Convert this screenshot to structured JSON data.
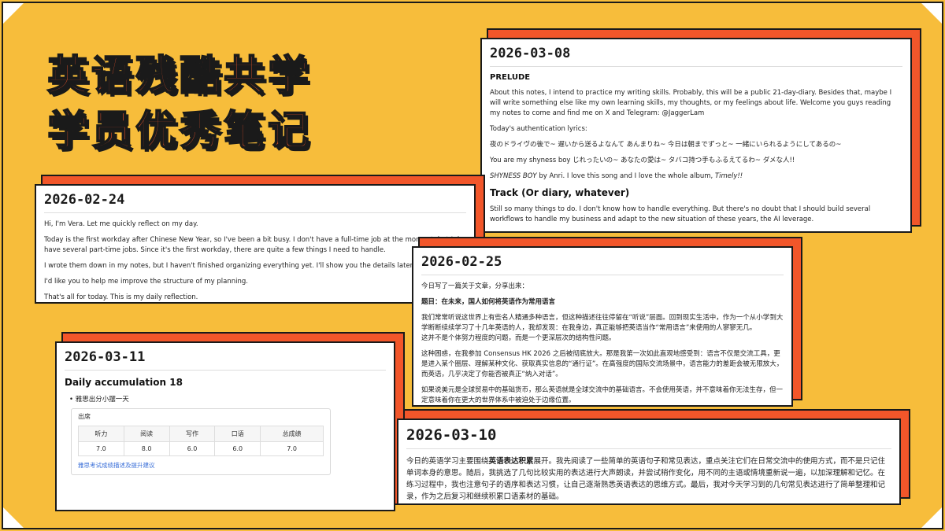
{
  "headline": {
    "line1": "英语残酷共学",
    "line2": "学员优秀笔记"
  },
  "cards": {
    "c0308": {
      "date": "2026-03-08",
      "h1": "PRELUDE",
      "p1": "About this notes, I intend to practice my writing skills. Probably, this will be a public 21-day-diary. Besides that, maybe I will write something else like my own learning skills, my thoughts, or my feelings about life. Welcome you guys reading my notes to come and find me on X and Telegram: @JaggerLam",
      "p2": "Today's authentication lyrics:",
      "p3": "夜のドライヴの後で~ 遅いから送るよなんて あんまりね~ 今日は朝までずっと~ 一緒にいられるようにしてあるの~",
      "p4": "You are my shyness boy じれったいの~ あなたの愛は~ タバコ持つ手もふるえてるわ~ ダメな人!!",
      "p5_song": "SHYNESS BOY",
      "p5_mid": " by Anri. I love this song and I love the whole album, ",
      "p5_album": "Timely!!",
      "h2": "Track (Or diary, whatever)",
      "p6": "Still so many things to do. I don't know how to handle everything. But there's no doubt that I should build several workflows to handle my business and adapt to the new situation of these years, the AI leverage."
    },
    "c0224": {
      "date": "2026-02-24",
      "p1": "Hi, I'm Vera. Let me quickly reflect on my day.",
      "p2": "Today is the first workday after Chinese New Year, so I've been a bit busy. I don't have a full-time job at the moment, but I do have several part-time jobs. Since it's the first workday, there are quite a few things I need to handle.",
      "p3": "I wrote them down in my notes, but I haven't finished organizing everything yet. I'll show you the details later.",
      "p4": "I'd like you to help me improve the structure of my planning.",
      "p5": "That's all for today. This is my daily reflection."
    },
    "c0225": {
      "date": "2026-02-25",
      "p1": "今日写了一篇关于文章，分享出来：",
      "p2": "题目：在未来，国人如何将英语作为常用语言",
      "p3": "我们常常听说这世界上有些名人精通多种语言，但这种描述往往停留在“听说”层面。回到现实生活中，作为一个从小学到大学断断续续学习了十几年英语的人，我却发现：在我身边，真正能够把英语当作“常用语言”来使用的人寥寥无几。",
      "p3b": "这并不是个体努力程度的问题，而是一个更深层次的结构性问题。",
      "p4": "这种困惑，在我参加 Consensus HK 2026 之后被彻底放大。那是我第一次如此直观地感受到：语言不仅是交流工具，更是进入某个圈层、理解某种文化、获取真实信息的“通行证”。在高强度的国际交流场景中，语言能力的差距会被无限放大，而英语，几乎决定了你能否被真正“纳入对话”。",
      "p5": "如果说美元是全球贸易中的基础货币，那么英语就是全球交流中的基础语言。不会使用英语，并不意味着你无法生存，但一定意味着你在更大的世界体系中被迫处于边缘位置。"
    },
    "c0311": {
      "date": "2026-03-11",
      "title": "Daily accumulation 18",
      "bullet": "雅思出分小摆一天",
      "sub_title": "出席",
      "headers": [
        "听力",
        "阅读",
        "写作",
        "口语",
        "总成绩"
      ],
      "scores": [
        "7.0",
        "8.0",
        "6.0",
        "6.0",
        "7.0"
      ],
      "link": "雅思考试成绩描述及提升建议"
    },
    "c0310": {
      "date": "2026-03-10",
      "p_a": "今日的英语学习主要围绕",
      "p_b": "英语表达积累",
      "p_c": "展开。我先阅读了一些简单的英语句子和常见表达，重点关注它们在日常交流中的使用方式，而不是只记住单词本身的意思。随后，我挑选了几句比较实用的表达进行大声朗读，并尝试稍作变化，用不同的主语或情境重新说一遍，以加深理解和记忆。在练习过程中，我也注意句子的语序和表达习惯，让自己逐渐熟悉英语表达的思维方式。最后，我对今天学习到的几句常见表达进行了简单整理和记录，作为之后复习和继续积累口语素材的基础。"
    }
  },
  "colors": {
    "background": "#f7bd3b",
    "accent": "#f2562a",
    "outline": "#1a1a1a"
  }
}
